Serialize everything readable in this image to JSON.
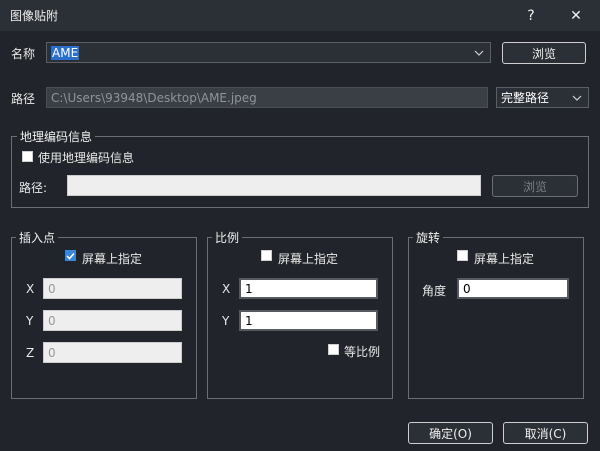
{
  "window": {
    "title": "图像贴附",
    "help": "?",
    "close": "✕"
  },
  "name": {
    "label": "名称",
    "value": "AME",
    "browse": "浏览"
  },
  "path": {
    "label": "路径",
    "value": "C:\\Users\\93948\\Desktop\\AME.jpeg",
    "mode": "完整路径"
  },
  "geo": {
    "legend": "地理编码信息",
    "checkbox_label": "使用地理编码信息",
    "path_label": "路径:",
    "path_value": "",
    "browse": "浏览"
  },
  "insert": {
    "legend": "插入点",
    "checkbox_label": "屏幕上指定",
    "x_label": "X",
    "x_value": "0",
    "y_label": "Y",
    "y_value": "0",
    "z_label": "Z",
    "z_value": "0"
  },
  "scale": {
    "legend": "比例",
    "checkbox_label": "屏幕上指定",
    "x_label": "X",
    "x_value": "1",
    "y_label": "Y",
    "y_value": "1",
    "uniform_label": "等比例"
  },
  "rotation": {
    "legend": "旋转",
    "checkbox_label": "屏幕上指定",
    "angle_label": "角度",
    "angle_value": "0"
  },
  "footer": {
    "ok": "确定(O)",
    "cancel": "取消(C)"
  }
}
